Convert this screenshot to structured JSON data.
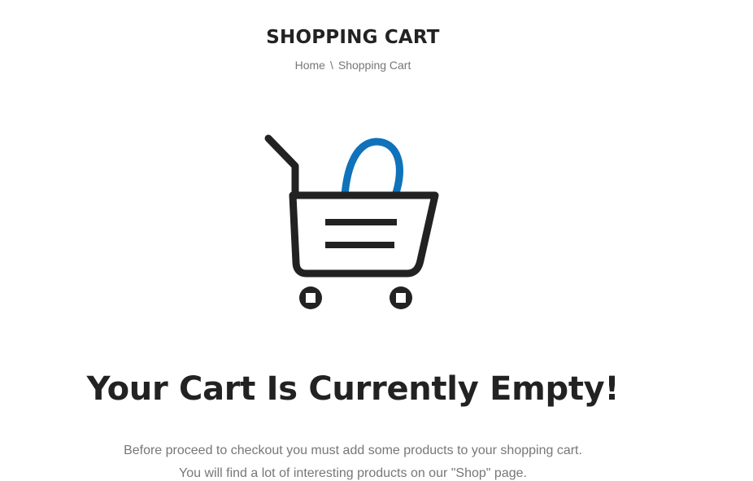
{
  "header": {
    "title": "SHOPPING CART",
    "breadcrumb": {
      "home_label": "Home",
      "separator": "\\",
      "current_label": "Shopping Cart"
    }
  },
  "illustration": {
    "icon": "shopping-cart-icon",
    "colors": {
      "cart": "#222222",
      "bag_handle": "#0f72ba"
    }
  },
  "empty_cart": {
    "heading": "Your Cart Is Currently Empty!",
    "line1": "Before proceed to checkout you must add some products to your shopping cart.",
    "line2": "You will find a lot of interesting products on our \"Shop\" page."
  }
}
